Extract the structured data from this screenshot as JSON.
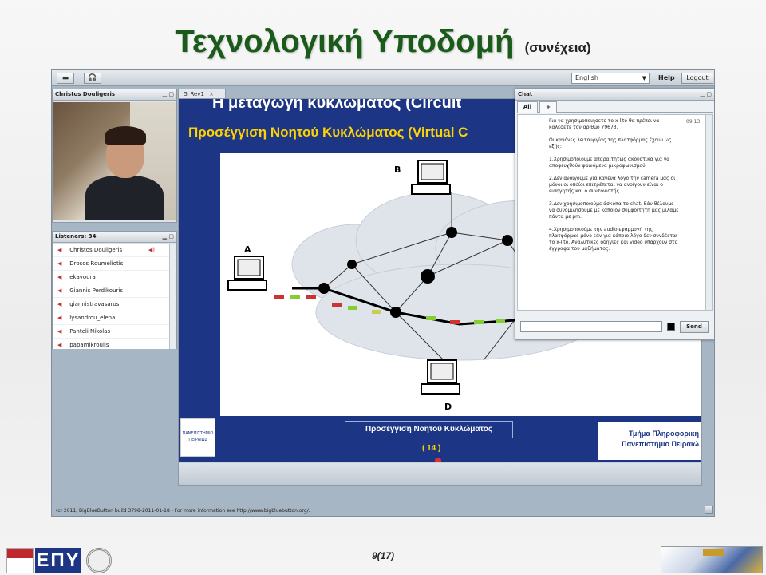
{
  "slide": {
    "title": "Τεχνολογική Υποδομή",
    "title_suffix": "(συνέχεια)",
    "page_number": "9(17)"
  },
  "app": {
    "toolbar": {
      "language": "English",
      "help": "Help",
      "logout": "Logout"
    },
    "video": {
      "title": "Christos Douligeris"
    },
    "listeners": {
      "title": "Listeners: 34",
      "items": [
        "Christos Douligeris",
        "Drosos Roumeliotis",
        "ekavoura",
        "Giannis Perdikouris",
        "giannistravasaros",
        "lysandrou_elena",
        "Panteli Nikolas",
        "papamikroulis"
      ]
    },
    "presentation": {
      "tab_label": "_5_Rev1",
      "slide_heading": "Η μεταγωγή κυκλώματος (Circuit",
      "slide_subheading": "Προσέγγιση Νοητού Κυκλώματος (Virtual C",
      "node_labels": [
        "B",
        "A",
        "D"
      ],
      "caption": "Προσέγγιση Νοητού Κυκλώματος",
      "page": "( 14 )",
      "dept_line1": "Τμήμα Πληροφορική",
      "dept_line2": "Πανεπιστήμιο Πειραιώ",
      "logo_text": "ΠΑΝΕΠΙΣΤΗΜΙΟ ΠΕΙΡΑΙΩΣ"
    },
    "chat": {
      "title": "Chat",
      "tabs": [
        "All",
        "+"
      ],
      "time": "09:13",
      "message": "Για να χρησιμοποιήσετε το x-lite θα πρέπει να καλέσετε τον αριθμό 79673.\n\nΟι κανόνες λειτουργίας της πλατφόρμας έχουν ως εξής:\n\n1.Χρησιμοποιούμε απαραιτήτως ακουστικά για να αποφευχθούν φαινόμενα μικροφωνισμού.\n\n2.Δεν ανοίγουμε για κανένα λόγο την camera μας οι μόνοι οι οποίοι επιτρέπεται να ανοίγουν είναι ο εισηγητής και ο συντονιστής.\n\n3.Δεν χρησιμοποιούμε άσκοπα το chat. Εάν θέλουμε να συνομιλήσουμε με κάποιον συμφοιτητή μας μιλάμε πάντα με pm.\n\n4.Χρησιμοποιούμε την audio εφαρμογή της πλατφόρμας μόνο εάν για κάποιο λόγο δεν συνδέεται το x-lite. Αναλυτικές οδηγίες και video υπάρχουν στα έγγραφα του μαθήματος.",
      "send": "Send"
    },
    "footer": "(c) 2011, BigBlueButton build 3798-2011-01-18 - For more information see http://www.bigbluebutton.org/.",
    "colors": {
      "slide_blue": "#1d3585",
      "slide_yellow": "#ffd300",
      "title_green": "#1a5a1a"
    }
  }
}
